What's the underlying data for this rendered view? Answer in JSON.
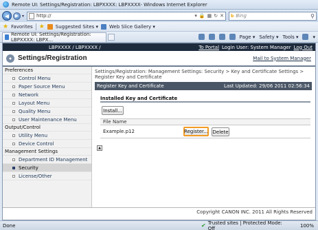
{
  "window": {
    "title": "Remote UI: Settings/Registration: LBPXXXX: LBPXXXX- Windows Internet Explorer"
  },
  "address_bar": {
    "url": "http://",
    "search_engine": "Bing",
    "search_placeholder": "Bing"
  },
  "favorites_bar": {
    "favorites_label": "Favorites",
    "items": [
      "Suggested Sites ▾",
      "Web Slice Gallery ▾"
    ]
  },
  "tab": {
    "label": "Remote UI: Settings/Registration: LBPXXXX: LBPX..."
  },
  "command_bar": {
    "page": "Page ▾",
    "safety": "Safety ▾",
    "tools": "Tools ▾",
    "help": "▾"
  },
  "page": {
    "model": "LBPXXXX / LBPXXXX /",
    "top_links": {
      "portal": "To Portal",
      "login": "Login User: System Manager",
      "logout": "Log Out"
    },
    "title": "Settings/Registration",
    "mail": "Mail to System Manager",
    "nav": {
      "preferences": "Preferences",
      "preferences_items": [
        "Control Menu",
        "Paper Source Menu",
        "Network",
        "Layout Menu",
        "Quality Menu",
        "User Maintenance Menu"
      ],
      "output": "Output/Control",
      "output_items": [
        "Utility Menu",
        "Device Control"
      ],
      "management": "Management Settings",
      "management_items": [
        "Department ID Management",
        "Security",
        "License/Other"
      ]
    },
    "breadcrumb": "Settings/Registration: Management Settings: Security > Key and Certificate Settings > Register Key and Certificate",
    "section_title": "Register Key and Certificate",
    "last_updated": "Last Updated: 29/06 2011 02:56:34",
    "subsection_title": "Installed Key and Certificate",
    "install_button": "Install...",
    "table": {
      "header": "File Name",
      "rows": [
        {
          "file_name": "Example.p12",
          "register": "Register...",
          "delete": "Delete"
        }
      ]
    },
    "copyright": "Copyright CANON INC. 2011 All Rights Reserved"
  },
  "status_bar": {
    "status": "Done",
    "zone": "Trusted sites | Protected Mode: Off",
    "zoom": "100%"
  }
}
